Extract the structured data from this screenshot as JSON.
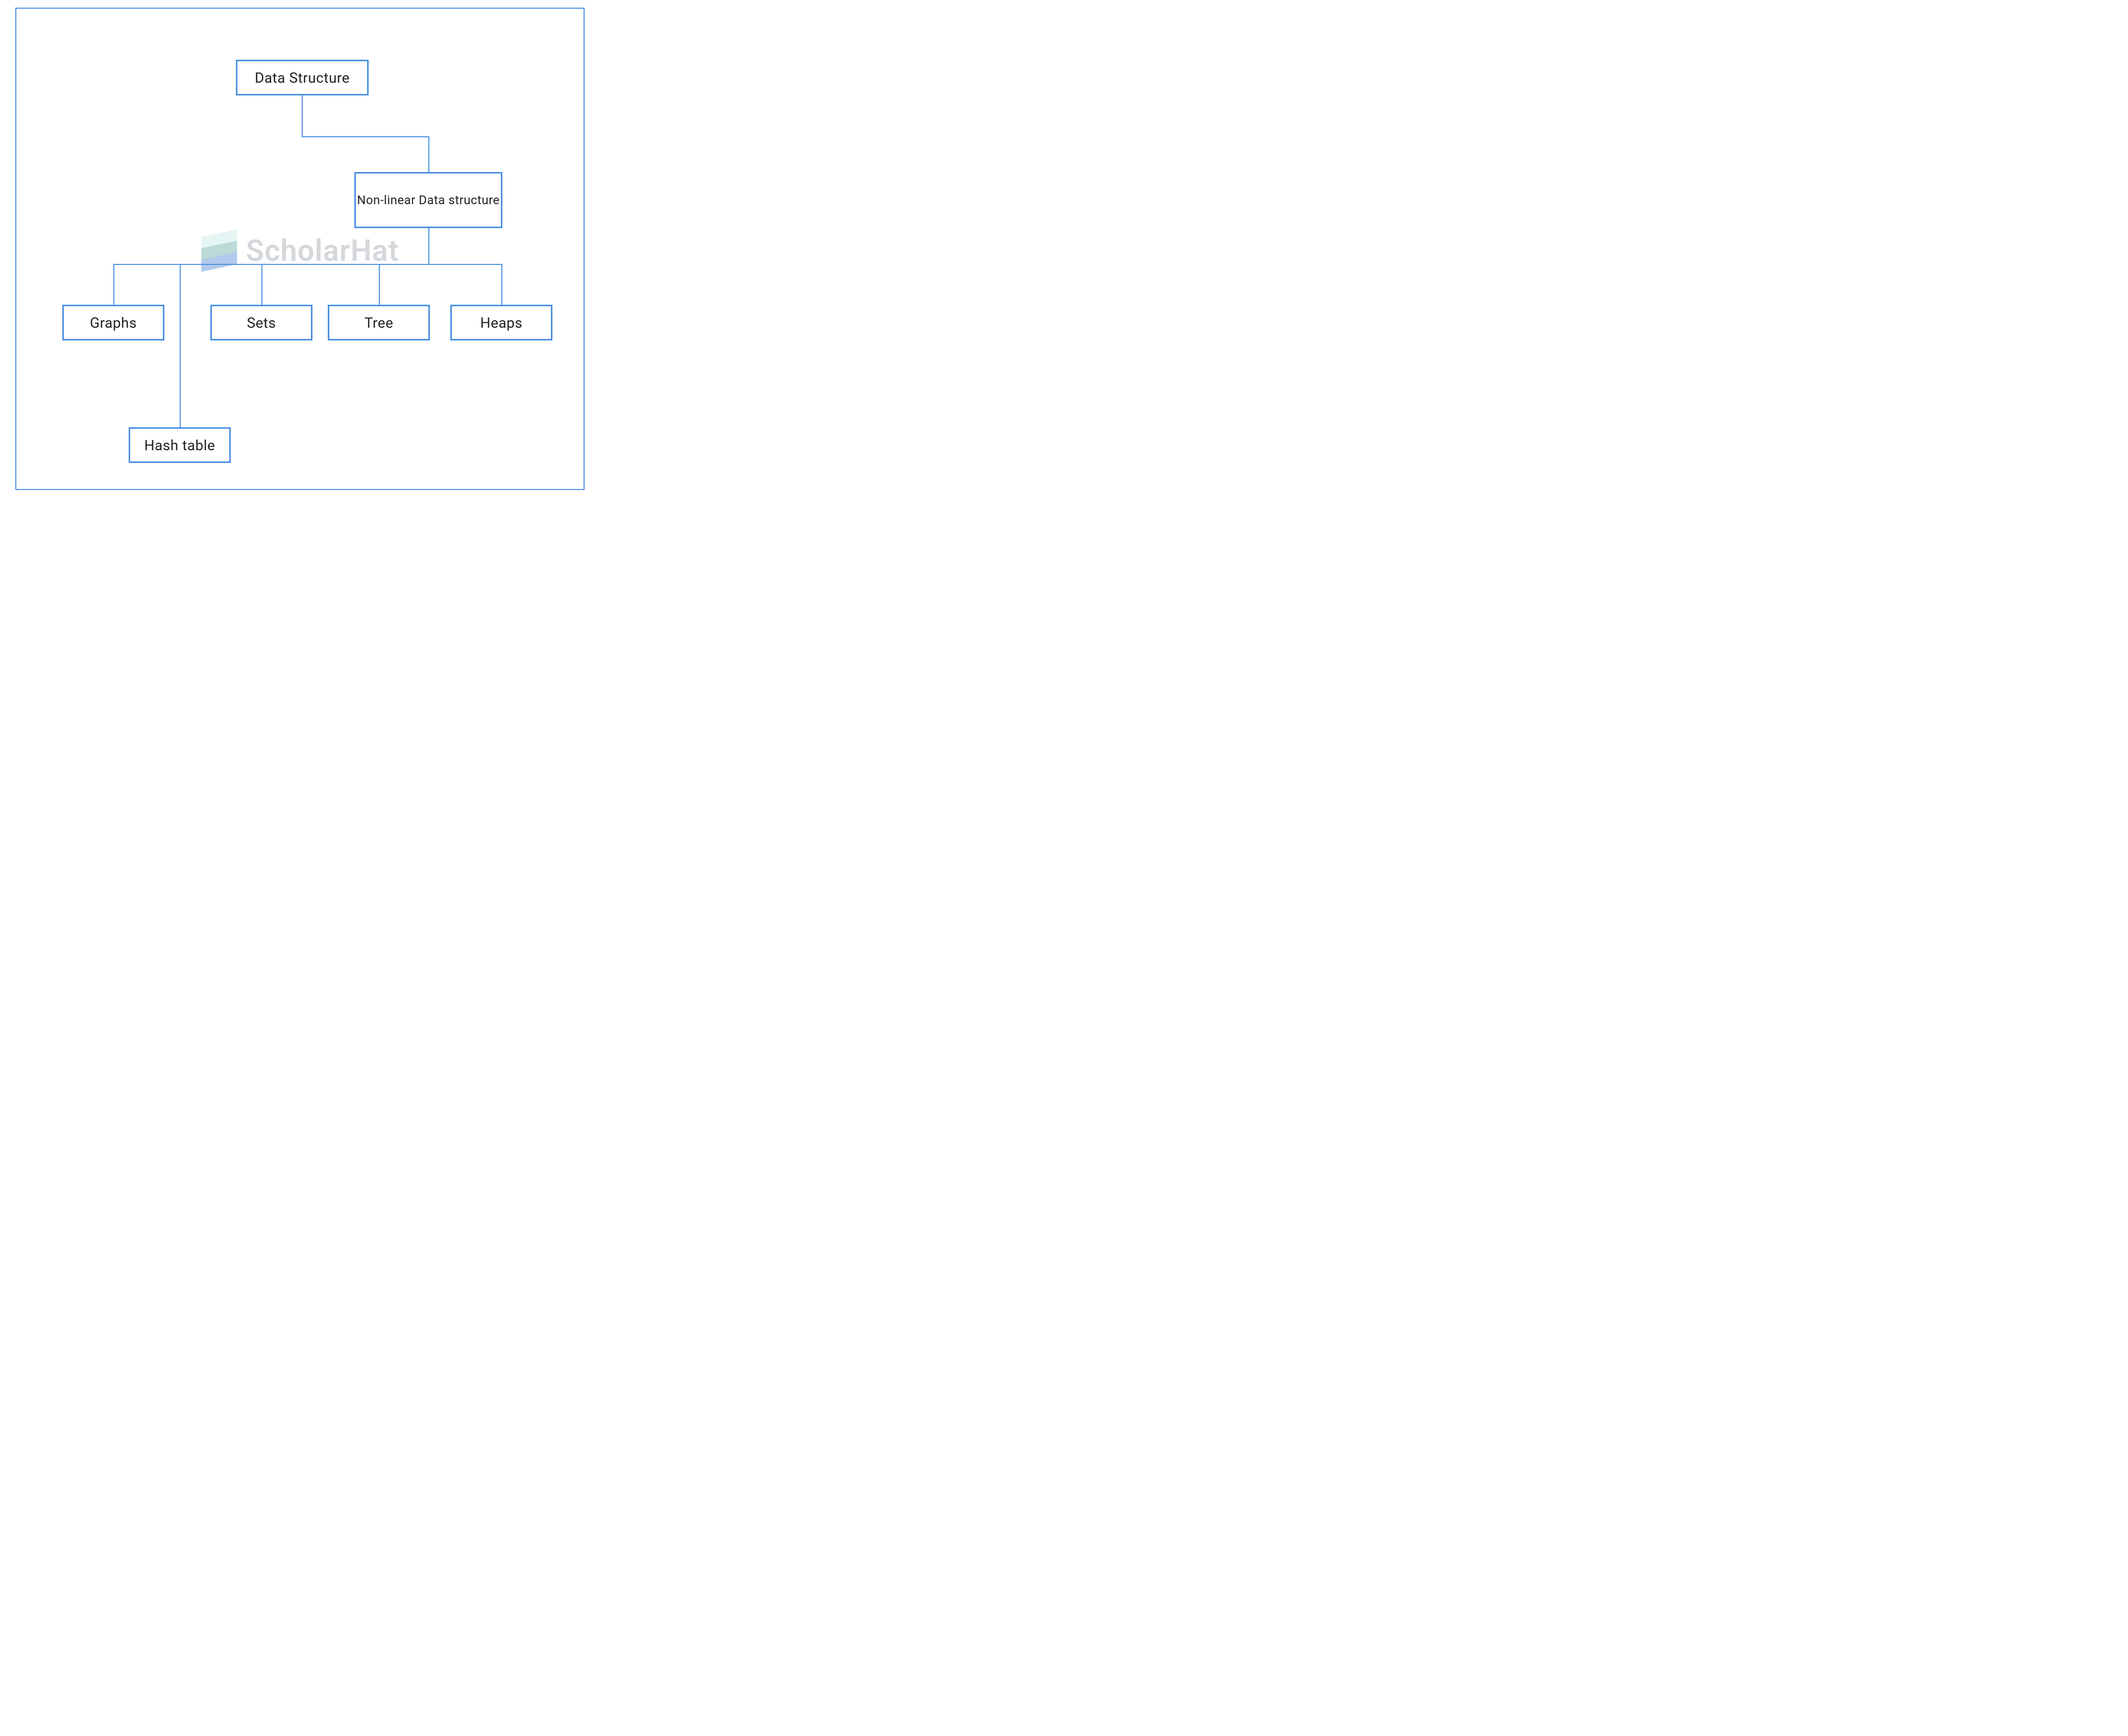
{
  "watermark": {
    "text": "ScholarHat"
  },
  "nodes": {
    "root": {
      "label": "Data Structure"
    },
    "nonlinear": {
      "label": "Non-linear Data structure"
    },
    "graphs": {
      "label": "Graphs"
    },
    "sets": {
      "label": "Sets"
    },
    "tree": {
      "label": "Tree"
    },
    "heaps": {
      "label": "Heaps"
    },
    "hash": {
      "label": "Hash table"
    }
  },
  "colors": {
    "node_border": "#4a90e2",
    "connector": "#4a90e2",
    "frame_border": "#4a90e2",
    "text": "#202124"
  }
}
